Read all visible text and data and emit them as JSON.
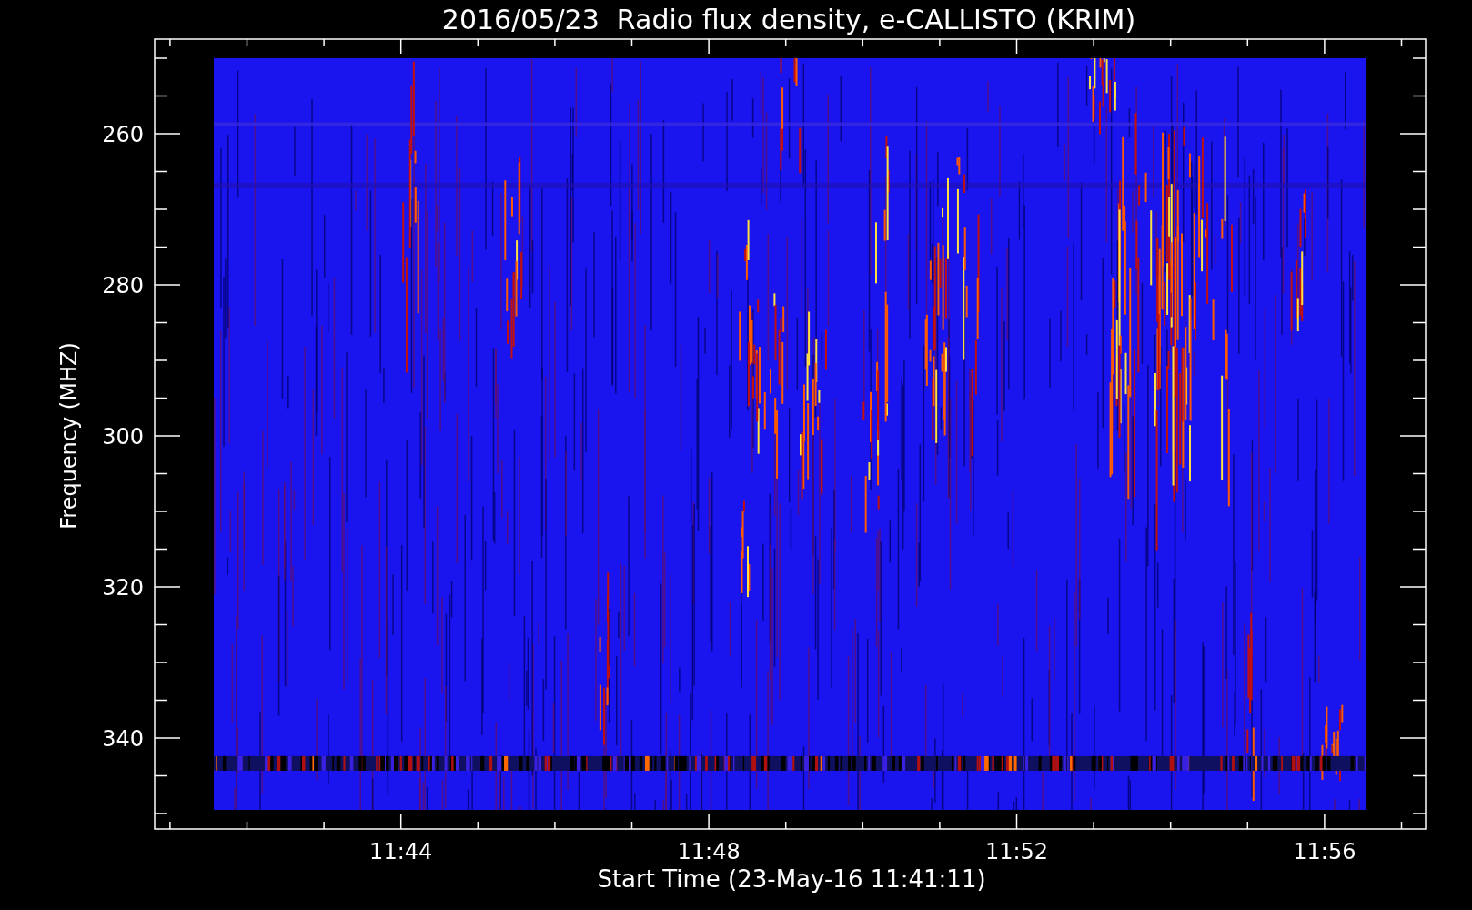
{
  "plot": {
    "title": "2016/05/23  Radio flux density, e-CALLISTO (KRIM)",
    "xlabel": "Start Time (23-May-16 11:41:11)",
    "ylabel": "Frequency (MHZ)",
    "xticks": [
      "11:44",
      "11:48",
      "11:52",
      "11:56"
    ],
    "yticks": [
      "260",
      "280",
      "300",
      "320",
      "340"
    ]
  }
}
